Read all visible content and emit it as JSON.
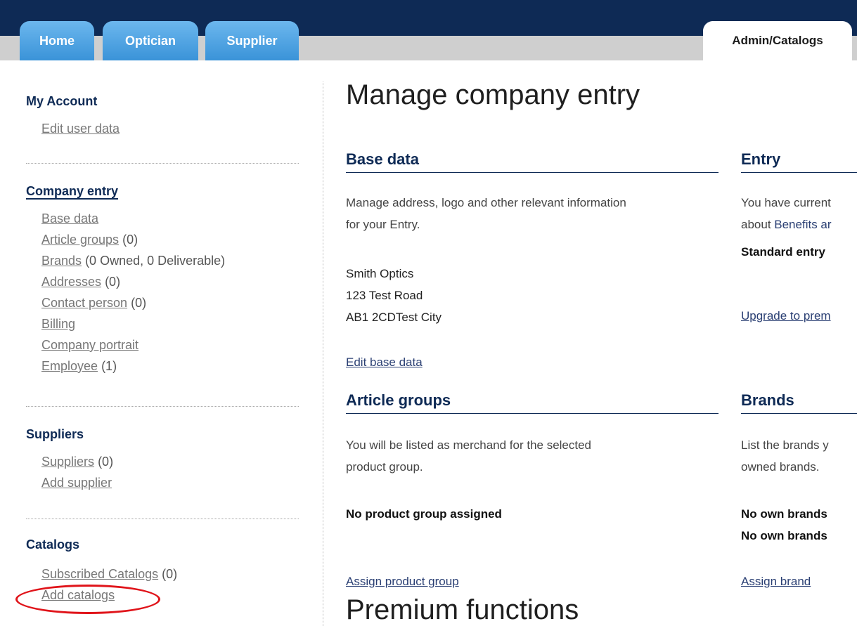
{
  "tabs": {
    "home": "Home",
    "optician": "Optician",
    "supplier": "Supplier",
    "admin": "Admin/Catalogs"
  },
  "sidebar": {
    "my_account": {
      "heading": "My Account",
      "items": [
        {
          "label": "Edit user data"
        }
      ]
    },
    "company_entry": {
      "heading": "Company entry",
      "items": [
        {
          "label": "Base data",
          "count": ""
        },
        {
          "label": "Article groups",
          "count": "(0)"
        },
        {
          "label": "Brands",
          "count": "(0 Owned, 0 Deliverable)"
        },
        {
          "label": "Addresses",
          "count": "(0)"
        },
        {
          "label": "Contact person",
          "count": "(0)"
        },
        {
          "label": "Billing",
          "count": ""
        },
        {
          "label": "Company portrait",
          "count": ""
        },
        {
          "label": "Employee",
          "count": "(1)"
        }
      ]
    },
    "suppliers": {
      "heading": "Suppliers",
      "items": [
        {
          "label": "Suppliers",
          "count": "(0)"
        },
        {
          "label": "Add supplier",
          "count": ""
        }
      ]
    },
    "catalogs": {
      "heading": "Catalogs",
      "items": [
        {
          "label": "Subscribed Catalogs",
          "count": "(0)"
        },
        {
          "label": "Add catalogs",
          "count": ""
        }
      ]
    }
  },
  "main": {
    "title": "Manage company entry",
    "base_data": {
      "heading": "Base data",
      "description_line1": "Manage address, logo and other relevant information",
      "description_line2": "for your Entry.",
      "address": [
        "Smith Optics",
        "123 Test Road",
        "AB1 2CDTest City"
      ],
      "edit_link": "Edit base data"
    },
    "entry": {
      "heading": "Entry",
      "line1": "You have current",
      "line2_prefix": "about ",
      "line2_link": "Benefits ar",
      "status": "Standard entry",
      "upgrade_link": "Upgrade to prem"
    },
    "article_groups": {
      "heading": "Article groups",
      "description_line1": "You will be listed as merchand for the selected",
      "description_line2": "product group.",
      "status": "No product group assigned",
      "assign_link": "Assign product group"
    },
    "brands": {
      "heading": "Brands",
      "description_line1": "List the brands y",
      "description_line2": "owned brands.",
      "status1": "No own brands",
      "status2": "No own brands",
      "assign_link": "Assign brand"
    },
    "premium_title": "Premium functions"
  },
  "colors": {
    "navy": "#0e2a55",
    "tab_blue": "#4aa3e4",
    "highlight_circle": "#e0141a"
  }
}
